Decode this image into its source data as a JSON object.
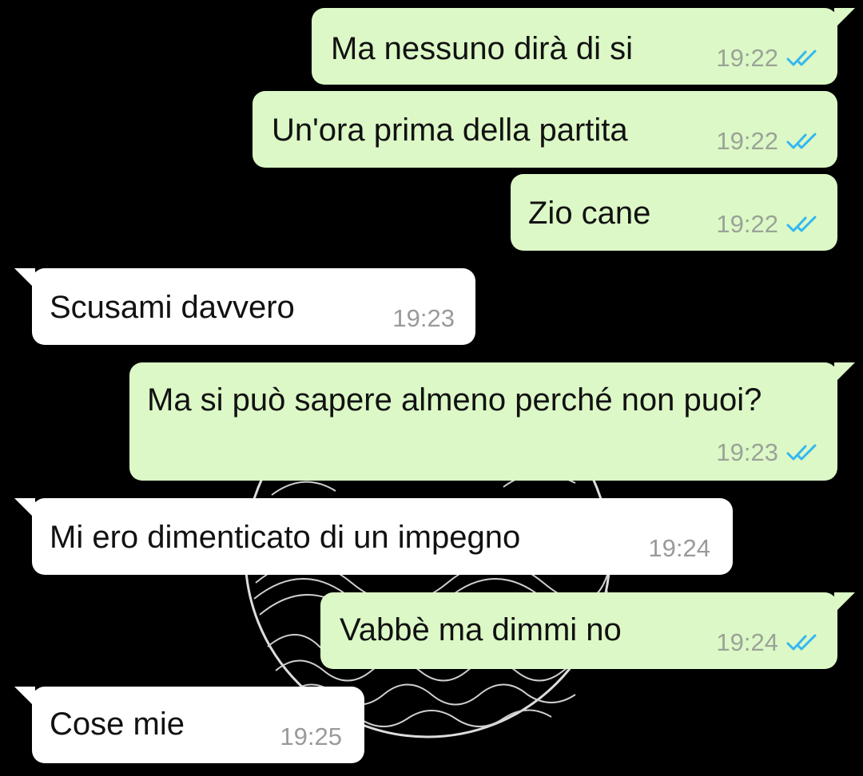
{
  "colors": {
    "background": "#000000",
    "outgoing_bubble": "#dcf8c6",
    "incoming_bubble": "#ffffff",
    "read_ticks": "#34b7f1",
    "timestamp": "#9aa398"
  },
  "messages": [
    {
      "direction": "out",
      "text": "Ma nessuno dirà di si",
      "time": "19:22",
      "status_icon": "double-check-read-icon"
    },
    {
      "direction": "out",
      "text": "Un'ora prima della partita",
      "time": "19:22",
      "status_icon": "double-check-read-icon"
    },
    {
      "direction": "out",
      "text": "Zio cane",
      "time": "19:22",
      "status_icon": "double-check-read-icon"
    },
    {
      "direction": "in",
      "text": "Scusami davvero",
      "time": "19:23"
    },
    {
      "direction": "out",
      "text": "Ma si può sapere almeno perché non puoi?",
      "time": "19:23",
      "status_icon": "double-check-read-icon"
    },
    {
      "direction": "in",
      "text": "Mi ero dimenticato di un impegno",
      "time": "19:24"
    },
    {
      "direction": "out",
      "text": "Vabbè ma dimmi no",
      "time": "19:24",
      "status_icon": "double-check-read-icon"
    },
    {
      "direction": "in",
      "text": "Cose mie",
      "time": "19:25"
    }
  ]
}
